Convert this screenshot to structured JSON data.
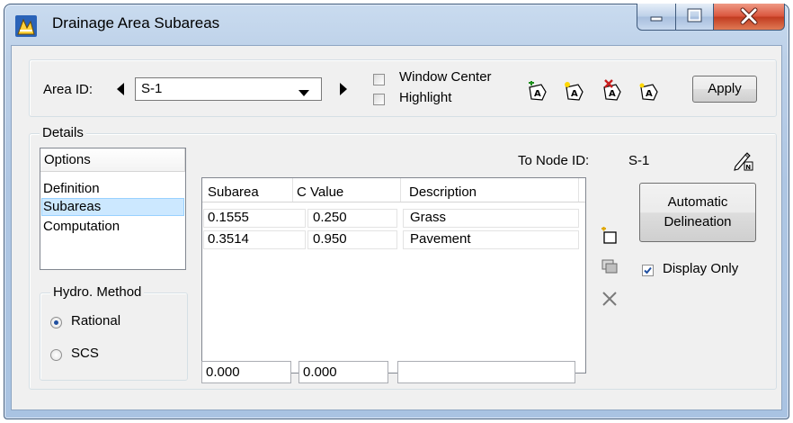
{
  "window": {
    "title": "Drainage Area Subareas",
    "icon": "app-icon"
  },
  "caption_buttons": {
    "minimize_icon": "minimize-icon",
    "maximize_icon": "maximize-icon",
    "close_icon": "close-icon"
  },
  "area": {
    "label": "Area ID:",
    "selected": "S-1",
    "prev_icon": "triangle-left-icon",
    "next_icon": "triangle-right-icon",
    "dropdown_icon": "chevron-down-icon"
  },
  "checkboxes": {
    "window_center": {
      "label": "Window Center",
      "checked": false
    },
    "highlight": {
      "label": "Highlight",
      "checked": false
    }
  },
  "toolbar_icons": [
    "add-area-icon",
    "select-area-icon",
    "delete-area-icon",
    "show-area-icon"
  ],
  "apply_label": "Apply",
  "details": {
    "group_label": "Details",
    "options_header": "Options",
    "options": [
      "Definition",
      "Subareas",
      "Computation"
    ],
    "selected_option": "Subareas",
    "to_node_label": "To Node ID:",
    "to_node_value": "S-1",
    "pick_node_icon": "pencil-node-icon"
  },
  "hydro_method": {
    "label": "Hydro. Method",
    "options": [
      "Rational",
      "SCS"
    ],
    "selected": "Rational"
  },
  "subarea_table": {
    "columns": [
      "Subarea",
      "C Value",
      "Description"
    ],
    "rows": [
      [
        "0.1555",
        "0.250",
        "Grass"
      ],
      [
        "0.3514",
        "0.950",
        "Pavement"
      ]
    ]
  },
  "entry_fields": {
    "subarea": "0.000",
    "c_value": "0.000",
    "description": ""
  },
  "row_actions": [
    "add-row-icon",
    "copy-row-icon",
    "delete-row-icon"
  ],
  "automatic_delineation": {
    "line1": "Automatic",
    "line2": "Delineation"
  },
  "display_only": {
    "label": "Display Only",
    "checked": true
  },
  "colors": {
    "selection": "#cce8ff",
    "title_gradient_top": "#c9dbef",
    "close_red": "#c13a1f"
  }
}
